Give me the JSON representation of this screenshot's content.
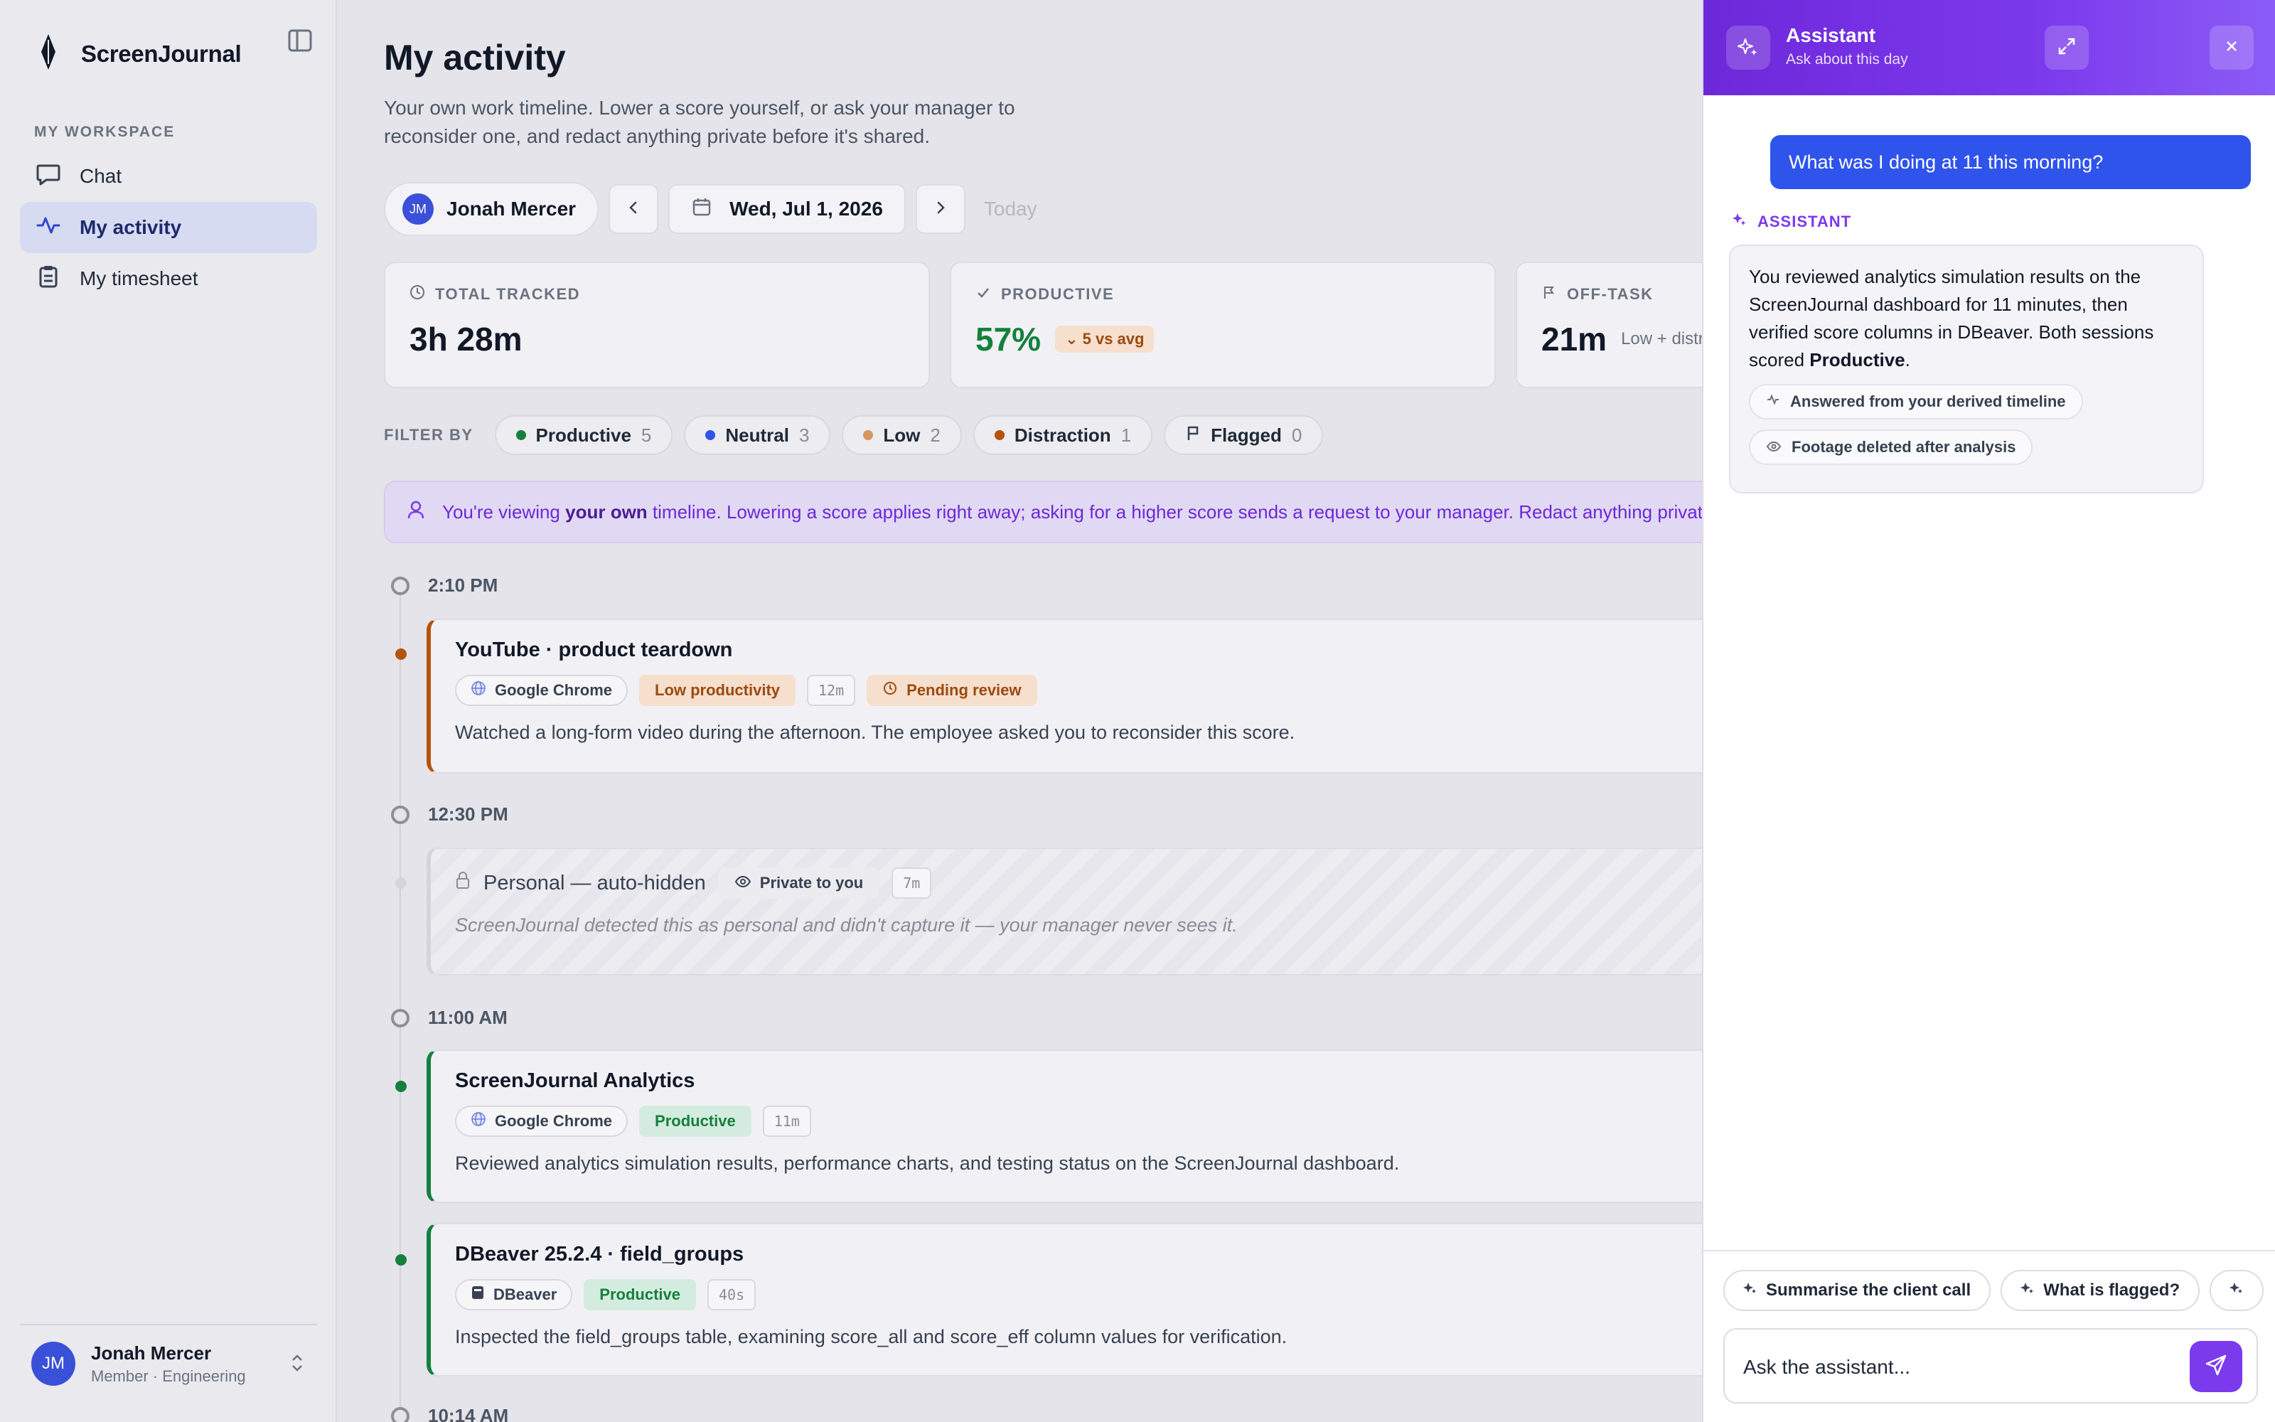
{
  "app": {
    "name": "ScreenJournal"
  },
  "sidebar": {
    "section_label": "MY WORKSPACE",
    "items": [
      {
        "label": "Chat",
        "icon": "chat-icon",
        "active": false
      },
      {
        "label": "My activity",
        "icon": "activity-icon",
        "active": true
      },
      {
        "label": "My timesheet",
        "icon": "clipboard-icon",
        "active": false
      }
    ],
    "user": {
      "initials": "JM",
      "name": "Jonah Mercer",
      "role": "Member · Engineering"
    }
  },
  "header": {
    "title": "My activity",
    "subtitle": "Your own work timeline. Lower a score yourself, or ask your manager to reconsider one, and redact anything private before it's shared."
  },
  "controls": {
    "person_initials": "JM",
    "person_name": "Jonah Mercer",
    "date": "Wed, Jul 1, 2026",
    "today_label": "Today"
  },
  "stats": [
    {
      "label": "TOTAL TRACKED",
      "value": "3h 28m",
      "icon": "clock-icon"
    },
    {
      "label": "PRODUCTIVE",
      "value": "57%",
      "badge": "5 vs avg",
      "icon": "check-icon"
    },
    {
      "label": "OFF-TASK",
      "value": "21m",
      "note": "Low + distraction",
      "icon": "flag-icon"
    }
  ],
  "filters": {
    "label": "FILTER BY",
    "chips": [
      {
        "label": "Productive",
        "count": "5",
        "color": "#15803d"
      },
      {
        "label": "Neutral",
        "count": "3",
        "color": "#2f54eb"
      },
      {
        "label": "Low",
        "count": "2",
        "color": "#d6975a"
      },
      {
        "label": "Distraction",
        "count": "1",
        "color": "#b45309"
      },
      {
        "label": "Flagged",
        "count": "0",
        "icon": "flag-icon"
      }
    ]
  },
  "banner": {
    "pre": "You're viewing ",
    "bold": "your own",
    "post": " timeline. Lowering a score applies right away; asking for a higher score sends a request to your manager. Redact anything private before it's shared."
  },
  "timeline": {
    "times": [
      "2:10 PM",
      "12:30 PM",
      "11:00 AM",
      "10:14 AM"
    ],
    "entries": [
      {
        "title": "YouTube · product teardown",
        "app": "Google Chrome",
        "score": "Low productivity",
        "duration": "12m",
        "status": "Pending review",
        "desc": "Watched a long-form video during the afternoon. The employee asked you to reconsider this score.",
        "accent": "#b45309"
      },
      {
        "title": "Personal — auto-hidden",
        "privacy": "Private to you",
        "duration": "7m",
        "desc": "ScreenJournal detected this as personal and didn't capture it — your manager never sees it."
      },
      {
        "title": "ScreenJournal Analytics",
        "app": "Google Chrome",
        "score": "Productive",
        "duration": "11m",
        "desc": "Reviewed analytics simulation results, performance charts, and testing status on the ScreenJournal dashboard.",
        "accent": "#15803d"
      },
      {
        "title": "DBeaver 25.2.4 · field_groups",
        "app": "DBeaver",
        "score": "Productive",
        "duration": "40s",
        "desc": "Inspected the field_groups table, examining score_all and score_eff column values for verification.",
        "accent": "#15803d"
      }
    ]
  },
  "assistant": {
    "title": "Assistant",
    "subtitle": "Ask about this day",
    "user_message": "What was I doing at 11 this morning?",
    "label": "ASSISTANT",
    "reply_pre": "You reviewed analytics simulation results on the ScreenJournal dashboard for 11 minutes, then verified score columns in DBeaver. Both sessions scored ",
    "reply_bold": "Productive",
    "reply_post": ".",
    "sources": [
      "Answered from your derived timeline",
      "Footage deleted after analysis"
    ],
    "suggestions": [
      "Summarise the client call",
      "What is flagged?"
    ],
    "input_placeholder": "Ask the assistant..."
  }
}
